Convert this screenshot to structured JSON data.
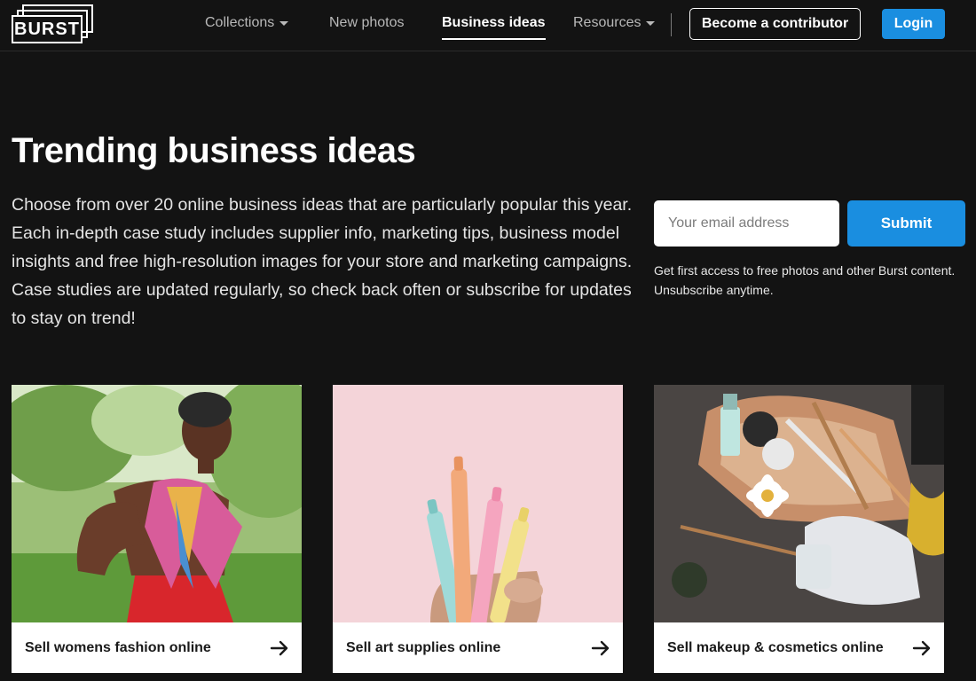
{
  "header": {
    "logo_text": "BURST",
    "nav": [
      {
        "label": "Collections",
        "has_dropdown": true,
        "active": false
      },
      {
        "label": "New photos",
        "has_dropdown": false,
        "active": false
      },
      {
        "label": "Business ideas",
        "has_dropdown": false,
        "active": true
      },
      {
        "label": "Resources",
        "has_dropdown": true,
        "active": false
      }
    ],
    "contributor_label": "Become a contributor",
    "login_label": "Login"
  },
  "hero": {
    "title": "Trending business ideas",
    "description": "Choose from over 20 online business ideas that are particularly popular this year. Each in-depth case study includes supplier info, marketing tips, business model insights and free high-resolution images for your store and marketing campaigns. Case studies are updated regularly, so check back often or subscribe for updates to stay on trend!"
  },
  "subscribe": {
    "email_placeholder": "Your email address",
    "email_value": "",
    "submit_label": "Submit",
    "note": "Get first access to free photos and other Burst content. Unsubscribe anytime."
  },
  "cards": [
    {
      "label": "Sell womens fashion online",
      "icon": "arrow-right-icon"
    },
    {
      "label": "Sell art supplies online",
      "icon": "arrow-right-icon"
    },
    {
      "label": "Sell makeup & cosmetics online",
      "icon": "arrow-right-icon"
    }
  ],
  "colors": {
    "background": "#131313",
    "accent": "#1a8ee0",
    "text": "#ffffff"
  }
}
